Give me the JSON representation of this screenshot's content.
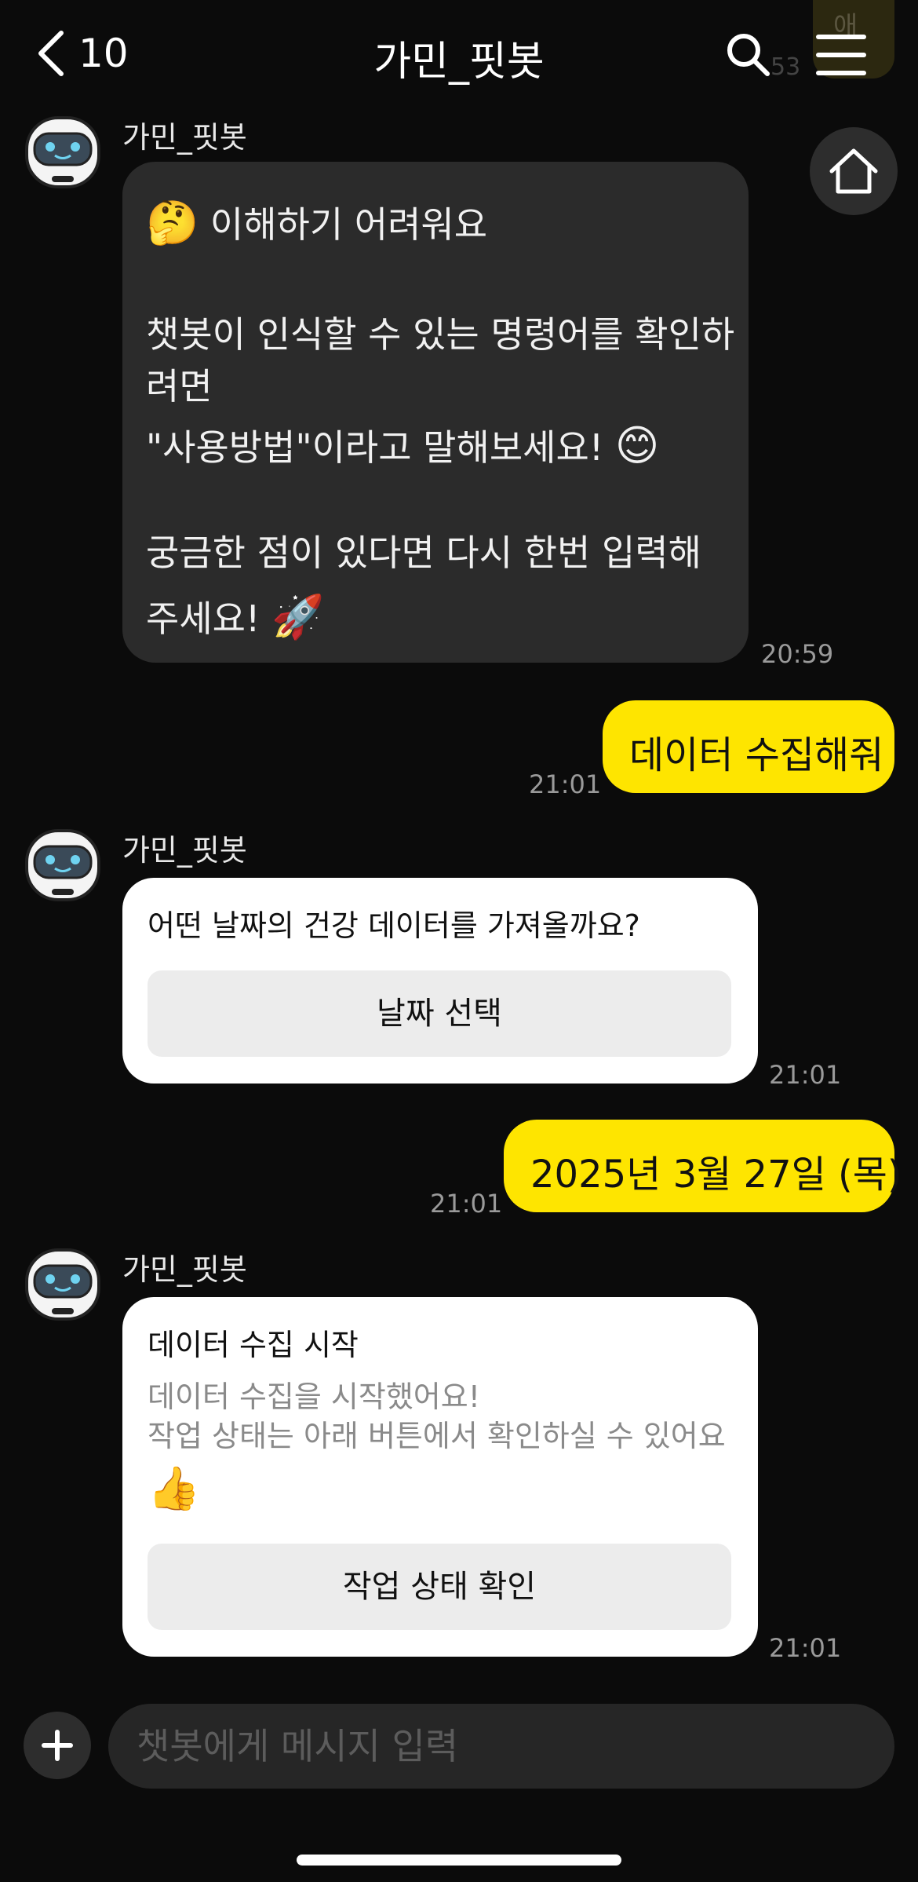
{
  "header": {
    "back_count": "10",
    "title": "가민_핏봇"
  },
  "peek": {
    "text": "애",
    "time": "53"
  },
  "messages": {
    "m1": {
      "sender": "가민_핏봇",
      "line1_emoji": "🤔",
      "line1": "이해하기 어려워요",
      "line2": "챗봇이 인식할 수 있는 명령어를 확인하",
      "line3": "려면",
      "line4": "\"사용방법\"이라고 말해보세요!",
      "line4_emoji": "😊",
      "line5": "궁금한 점이 있다면 다시 한번 입력해",
      "line6": "주세요!",
      "line6_emoji": "🚀",
      "time": "20:59"
    },
    "m2": {
      "text": "데이터 수집해줘",
      "time": "21:01"
    },
    "m3": {
      "sender": "가민_핏봇",
      "question": "어떤 날짜의 건강 데이터를 가져올까요?",
      "button": "날짜 선택",
      "time": "21:01"
    },
    "m4": {
      "text": "2025년 3월 27일 (목)",
      "time": "21:01"
    },
    "m5": {
      "sender": "가민_핏봇",
      "title": "데이터 수집 시작",
      "desc1": "데이터 수집을 시작했어요!",
      "desc2": "작업 상태는 아래 버튼에서 확인하실 수 있어요",
      "desc_emoji": "👍",
      "button": "작업 상태 확인",
      "time": "21:01"
    }
  },
  "input": {
    "placeholder": "챗봇에게 메시지 입력"
  },
  "icons": {
    "back": "chevron-left-icon",
    "search": "search-icon",
    "menu": "hamburger-menu-icon",
    "home": "home-icon",
    "plus": "plus-icon",
    "avatar": "robot-avatar-icon"
  },
  "colors": {
    "accent_yellow": "#fee500",
    "background": "#0b0b0b",
    "bubble_dark": "#2b2b2b"
  }
}
